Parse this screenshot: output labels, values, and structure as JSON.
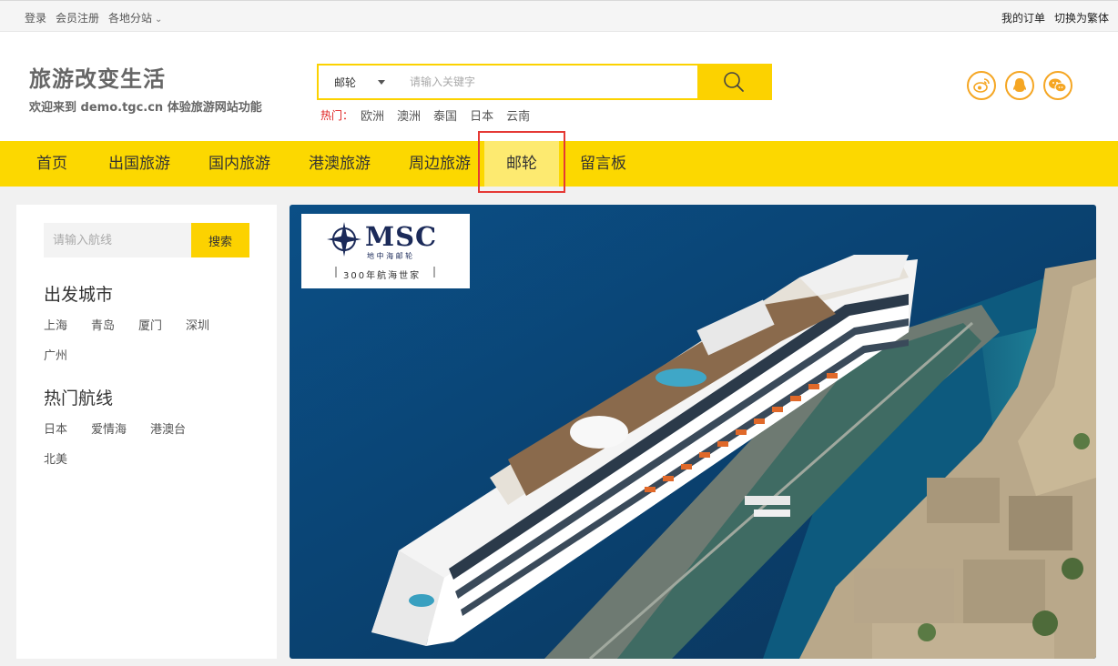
{
  "topbar": {
    "login": "登录",
    "register": "会员注册",
    "branches": "各地分站",
    "orders": "我的订单",
    "switch_lang": "切换为繁体"
  },
  "header": {
    "title": "旅游改变生活",
    "subtitle": "欢迎来到 demo.tgc.cn 体验旅游网站功能"
  },
  "search": {
    "category": "邮轮",
    "placeholder": "请输入关键字",
    "hot_label": "热门：",
    "hot_items": [
      "欧洲",
      "澳洲",
      "泰国",
      "日本",
      "云南"
    ]
  },
  "social": [
    "weibo-icon",
    "qq-icon",
    "wechat-icon"
  ],
  "nav": {
    "items": [
      "首页",
      "出国旅游",
      "国内旅游",
      "港澳旅游",
      "周边旅游",
      "邮轮",
      "留言板"
    ],
    "active_index": 5
  },
  "sidebar": {
    "search_placeholder": "请输入航线",
    "search_button": "搜索",
    "departure_title": "出发城市",
    "departure_cities": [
      "上海",
      "青岛",
      "厦门",
      "深圳",
      "广州"
    ],
    "hot_routes_title": "热门航线",
    "hot_routes": [
      "日本",
      "爱情海",
      "港澳台",
      "北美"
    ]
  },
  "banner": {
    "brand": "MSC",
    "brand_sub": "地 中 海 邮 轮",
    "tagline": "300年航海世家"
  },
  "colors": {
    "accent": "#fcd800",
    "hot_red": "#e02020",
    "highlight_border": "#e53935",
    "sea": "#0d4a78"
  }
}
